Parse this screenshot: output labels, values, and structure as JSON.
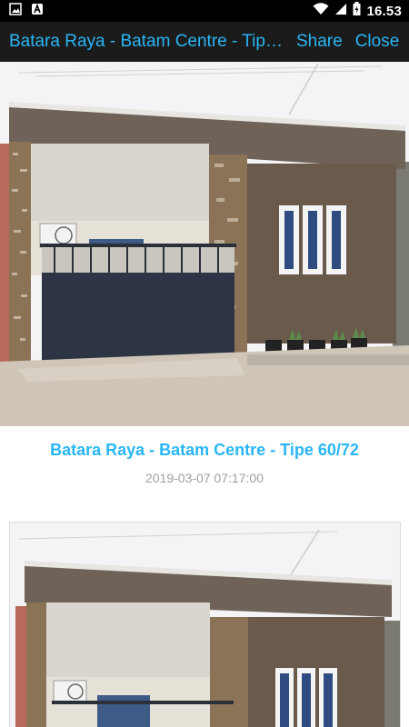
{
  "status_bar": {
    "time": "16.53",
    "icons": [
      "image-notification-icon",
      "app-notification-icon",
      "wifi-icon",
      "signal-icon",
      "battery-icon"
    ]
  },
  "app_bar": {
    "title": "Batara Raya - Batam Centre - Tipe 60/72",
    "share_label": "Share",
    "close_label": "Close"
  },
  "post": {
    "title": "Batara Raya - Batam Centre - Tipe 60/72",
    "date": "2019-03-07 07:17:00"
  },
  "colors": {
    "accent": "#29b6f6",
    "status_bar": "#000000",
    "app_bar": "#1b1b1b",
    "date_text": "#9e9e9e"
  }
}
